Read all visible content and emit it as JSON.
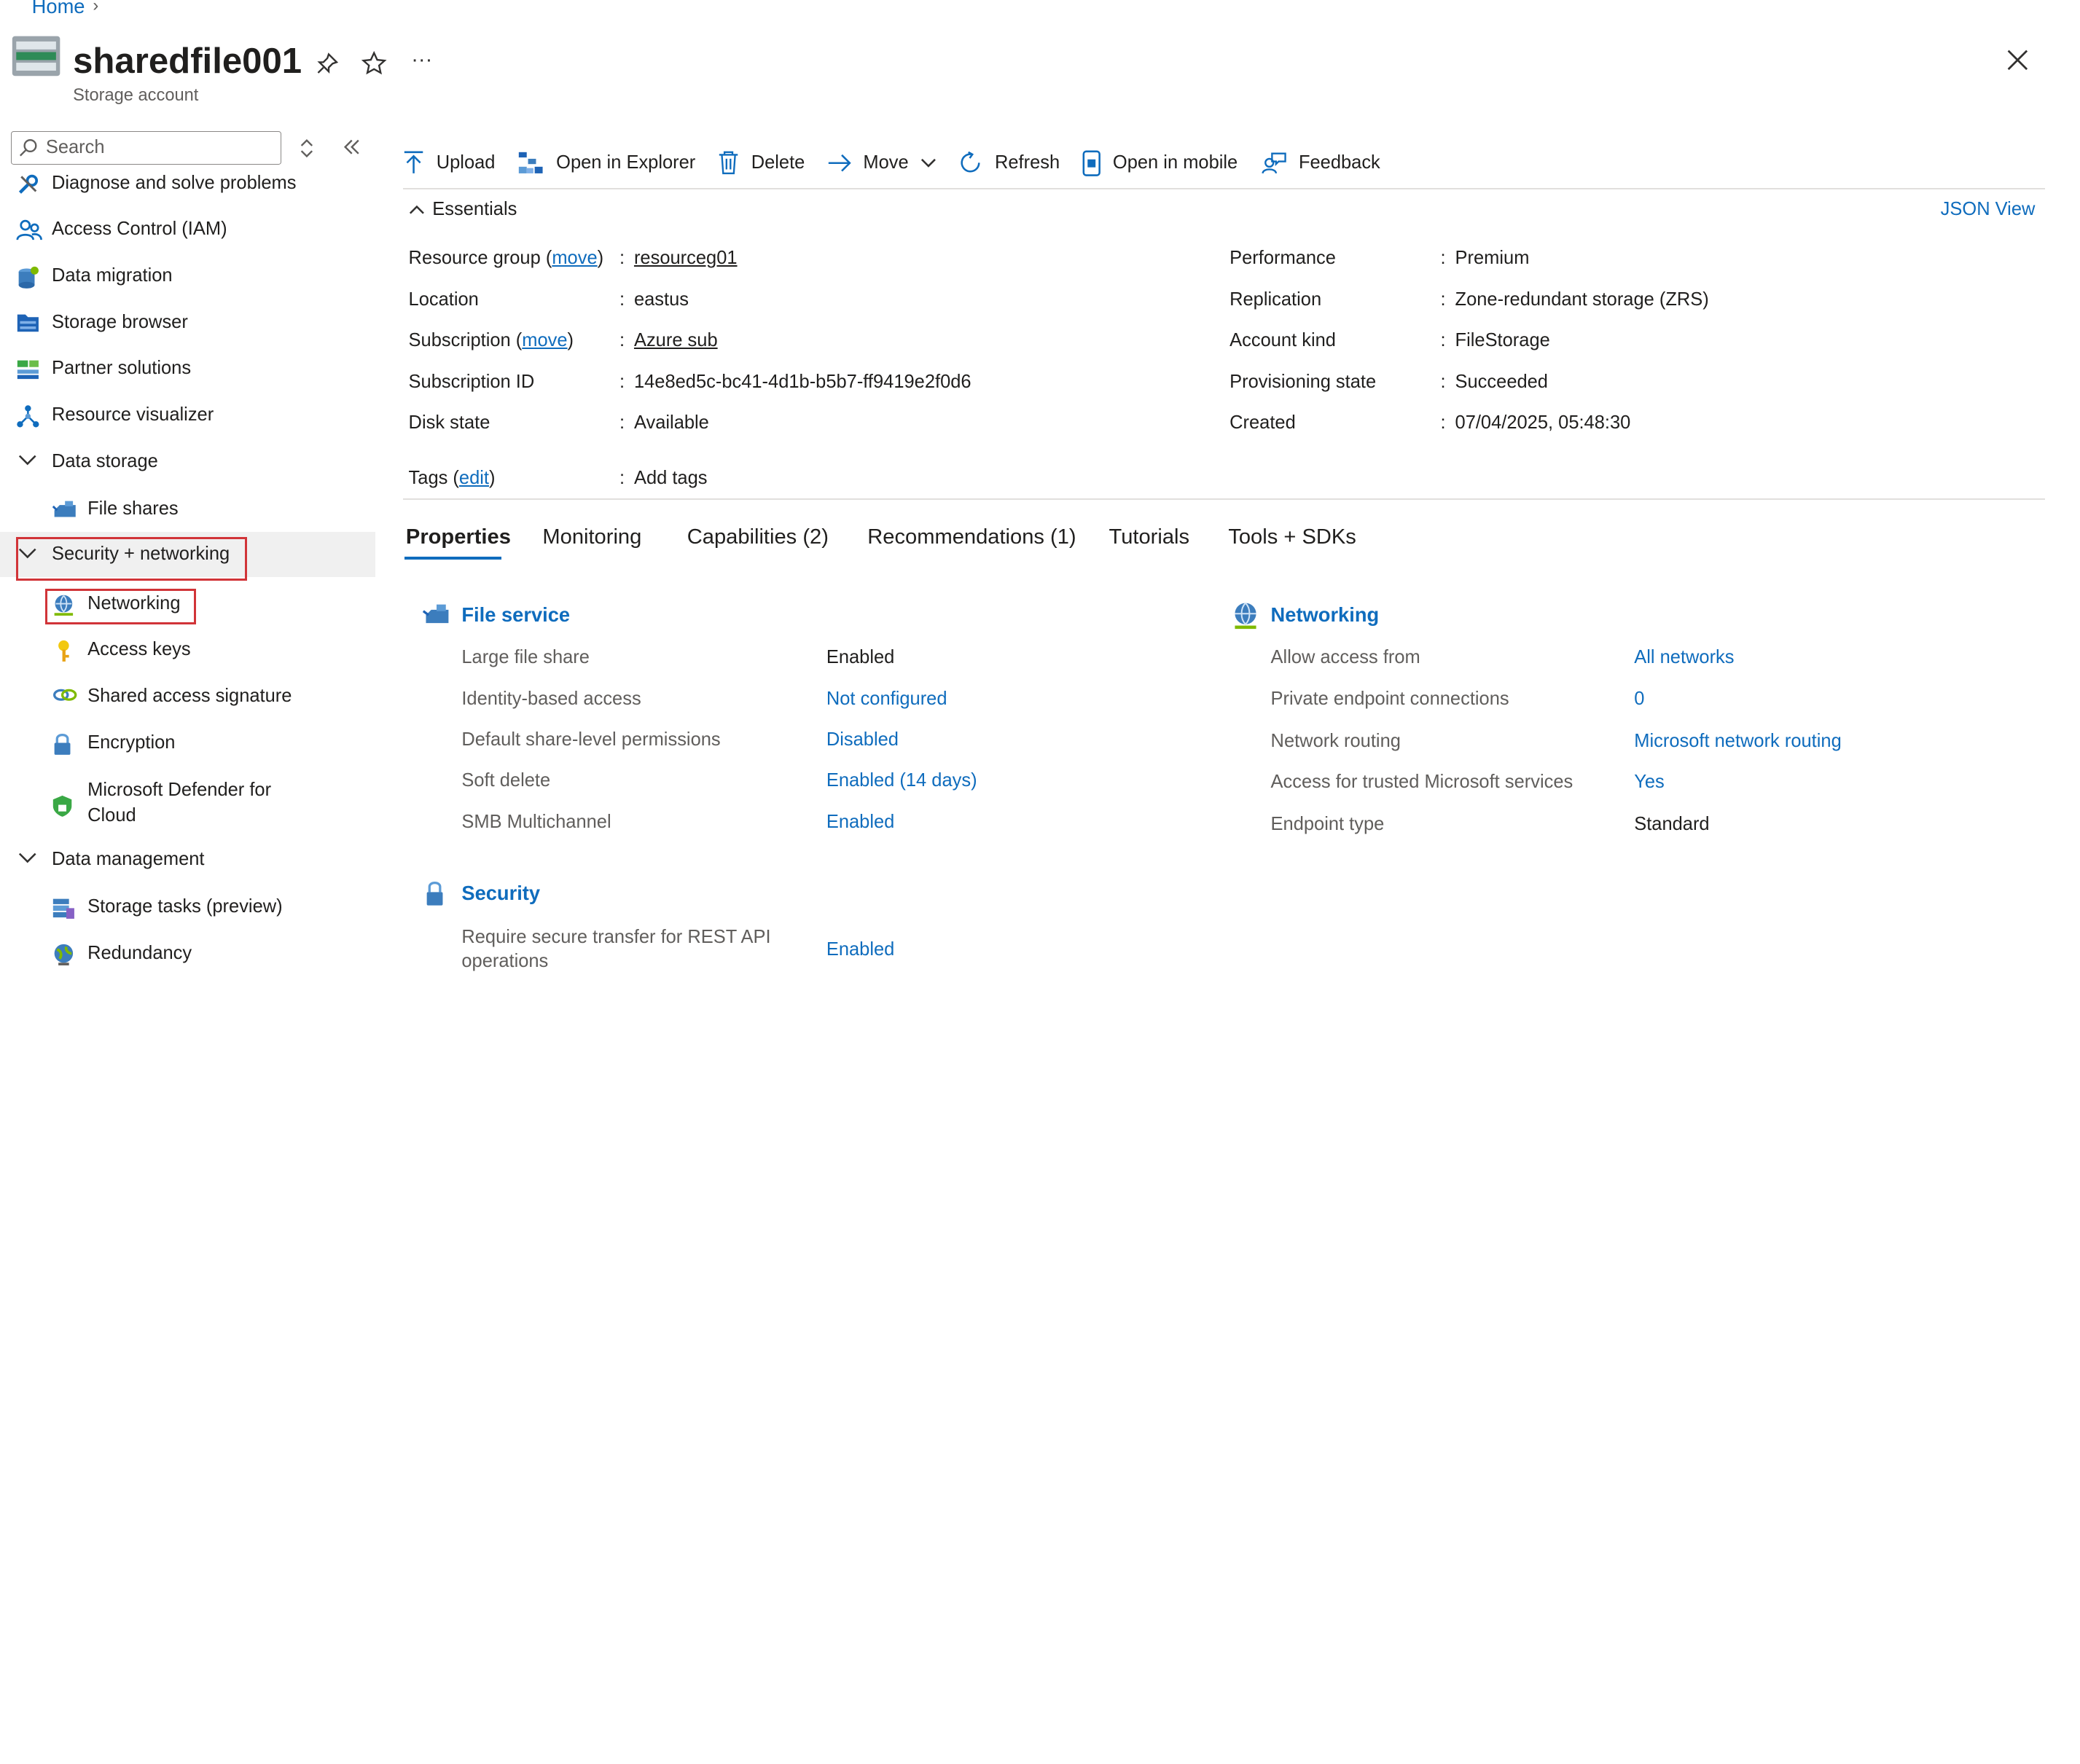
{
  "breadcrumb": {
    "home": "Home"
  },
  "resource": {
    "title": "sharedfile001",
    "subtitle": "Storage account"
  },
  "header": {
    "more": "···"
  },
  "sidebar": {
    "search_placeholder": "Search",
    "items": [
      {
        "label": "Diagnose and solve problems",
        "icon": "wrench-icon"
      },
      {
        "label": "Access Control (IAM)",
        "icon": "people-icon"
      },
      {
        "label": "Data migration",
        "icon": "migration-icon"
      },
      {
        "label": "Storage browser",
        "icon": "folder-icon"
      },
      {
        "label": "Partner solutions",
        "icon": "partner-icon"
      },
      {
        "label": "Resource visualizer",
        "icon": "visualizer-icon"
      }
    ],
    "groups": {
      "data_storage": {
        "label": "Data storage",
        "items": [
          "File shares"
        ]
      },
      "security": {
        "label": "Security + networking",
        "items": [
          "Networking",
          "Access keys",
          "Shared access signature",
          "Encryption",
          "Microsoft Defender for",
          "Cloud"
        ]
      },
      "data_management": {
        "label": "Data management",
        "items": [
          "Storage tasks (preview)",
          "Redundancy"
        ]
      }
    }
  },
  "toolbar": {
    "upload": "Upload",
    "open_explorer": "Open in Explorer",
    "delete": "Delete",
    "move": "Move",
    "refresh": "Refresh",
    "open_mobile": "Open in mobile",
    "feedback": "Feedback"
  },
  "essentials": {
    "title": "Essentials",
    "json_view": "JSON View",
    "move": "move",
    "edit": "edit",
    "left": {
      "resource_group_label": "Resource group (",
      "resource_group": "resourceg01",
      "location_label": "Location",
      "location": "eastus",
      "subscription_label": "Subscription (",
      "subscription": "Azure sub",
      "subscription_id_label": "Subscription ID",
      "subscription_id": "14e8ed5c-bc41-4d1b-b5b7-ff9419e2f0d6",
      "disk_state_label": "Disk state",
      "disk_state": "Available",
      "tags_label": "Tags (",
      "tags": "Add tags"
    },
    "right": {
      "performance_label": "Performance",
      "performance": "Premium",
      "replication_label": "Replication",
      "replication": "Zone-redundant storage (ZRS)",
      "account_kind_label": "Account kind",
      "account_kind": "FileStorage",
      "provisioning_label": "Provisioning state",
      "provisioning": "Succeeded",
      "created_label": "Created",
      "created": "07/04/2025, 05:48:30"
    }
  },
  "tabs": [
    "Properties",
    "Monitoring",
    "Capabilities (2)",
    "Recommendations (1)",
    "Tutorials",
    "Tools + SDKs"
  ],
  "file_service": {
    "title": "File service",
    "rows": [
      {
        "k": "Large file share",
        "v": "Enabled"
      },
      {
        "k": "Identity-based access",
        "v": "Not configured"
      },
      {
        "k": "Default share-level permissions",
        "v": "Disabled"
      },
      {
        "k": "Soft delete",
        "v": "Enabled (14 days)"
      },
      {
        "k": "SMB Multichannel",
        "v": "Enabled"
      }
    ]
  },
  "networking": {
    "title": "Networking",
    "rows": [
      {
        "k": "Allow access from",
        "v": "All networks"
      },
      {
        "k": "Private endpoint connections",
        "v": "0"
      },
      {
        "k": "Network routing",
        "v": "Microsoft network routing"
      },
      {
        "k": "Access for trusted Microsoft services",
        "v": "Yes"
      },
      {
        "k": "Endpoint type",
        "v": "Standard"
      }
    ]
  },
  "security": {
    "title": "Security",
    "rows": [
      {
        "k1": "Require secure transfer for REST API",
        "k2": "operations",
        "v": "Enabled"
      }
    ]
  },
  "colors": {
    "accent": "#0f6cbd",
    "highlight": "#d13438",
    "selected_bg": "#f0f0f0"
  }
}
